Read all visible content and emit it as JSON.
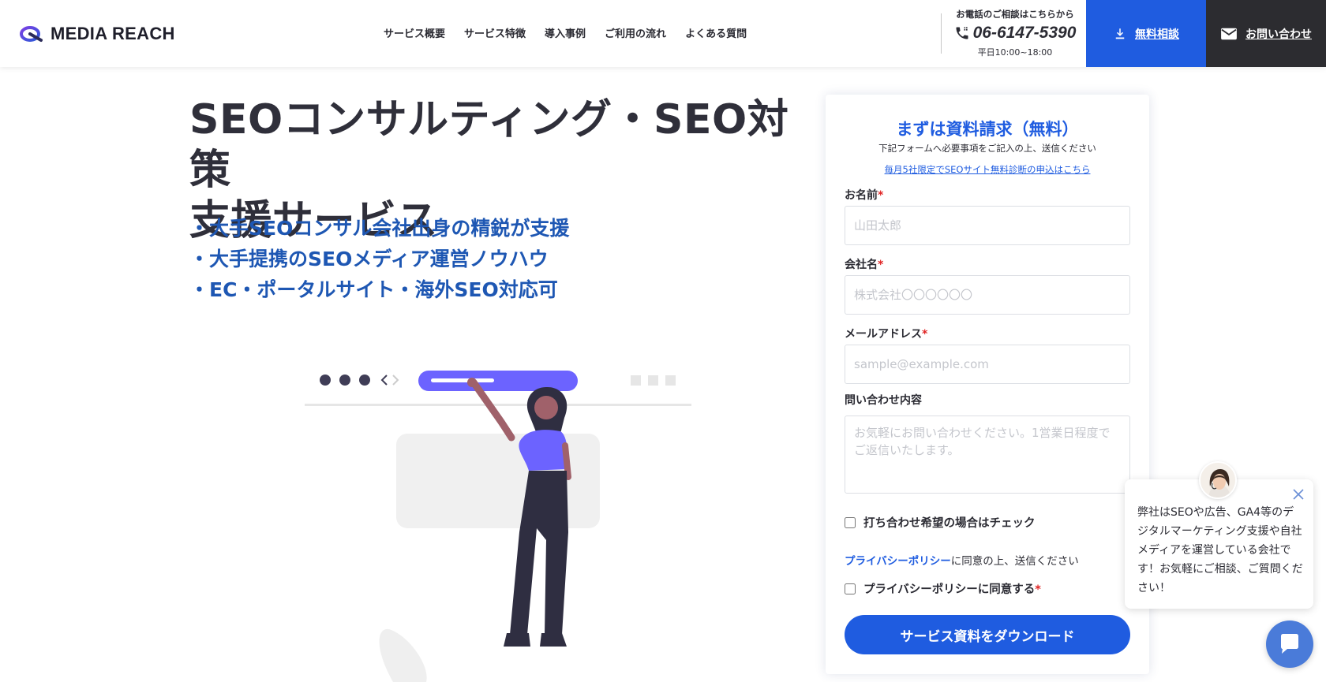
{
  "colors": {
    "accent": "#1f5ce0",
    "dark": "#2c2c30",
    "bullet_blue": "#1e57b3",
    "illus_purple": "#6c63ff"
  },
  "header": {
    "logo_text": "MEDIA REACH",
    "nav": [
      "サービス概要",
      "サービス特徴",
      "導入事例",
      "ご利用の流れ",
      "よくある質問"
    ],
    "phone_caption": "お電話のご相談はこちらから",
    "phone_number": "06-6147-5390",
    "phone_hours": "平日10:00~18:00",
    "consult_label": "無料相談",
    "contact_label": "お問い合わせ"
  },
  "hero": {
    "title_line1": "SEOコンサルティング・SEO対策",
    "title_line2": "支援サービス",
    "bullets": [
      "・大手SEOコンサル会社出身の精鋭が支援",
      "・大手提携のSEOメディア運営ノウハウ",
      "・EC・ポータルサイト・海外SEO対応可"
    ]
  },
  "form": {
    "title": "まずは資料請求（無料）",
    "subtitle": "下記フォームへ必要事項をご記入の上、送信ください",
    "promo_link": "毎月5社限定でSEOサイト無料診断の申込はこちら",
    "name_label": "お名前",
    "name_placeholder": "山田太郎",
    "company_label": "会社名",
    "company_placeholder": "株式会社〇〇〇〇〇〇",
    "email_label": "メールアドレス",
    "email_placeholder": "sample@example.com",
    "inquiry_label": "問い合わせ内容",
    "inquiry_placeholder": "お気軽にお問い合わせください。1営業日程度でご返信いたします。",
    "meeting_check_label": "打ち合わせ希望の場合はチェック",
    "privacy_link": "プライバシーポリシー",
    "privacy_text": "に同意の上、送信ください",
    "privacy_check_label": "プライバシーポリシーに同意する",
    "required_mark": "*",
    "submit_label": "サービス資料をダウンロード"
  },
  "chat": {
    "message": "弊社はSEOや広告、GA4等のデジタルマーケティング支援や自社メディアを運営している会社です！お気軽にご相談、ご質問ください！"
  }
}
